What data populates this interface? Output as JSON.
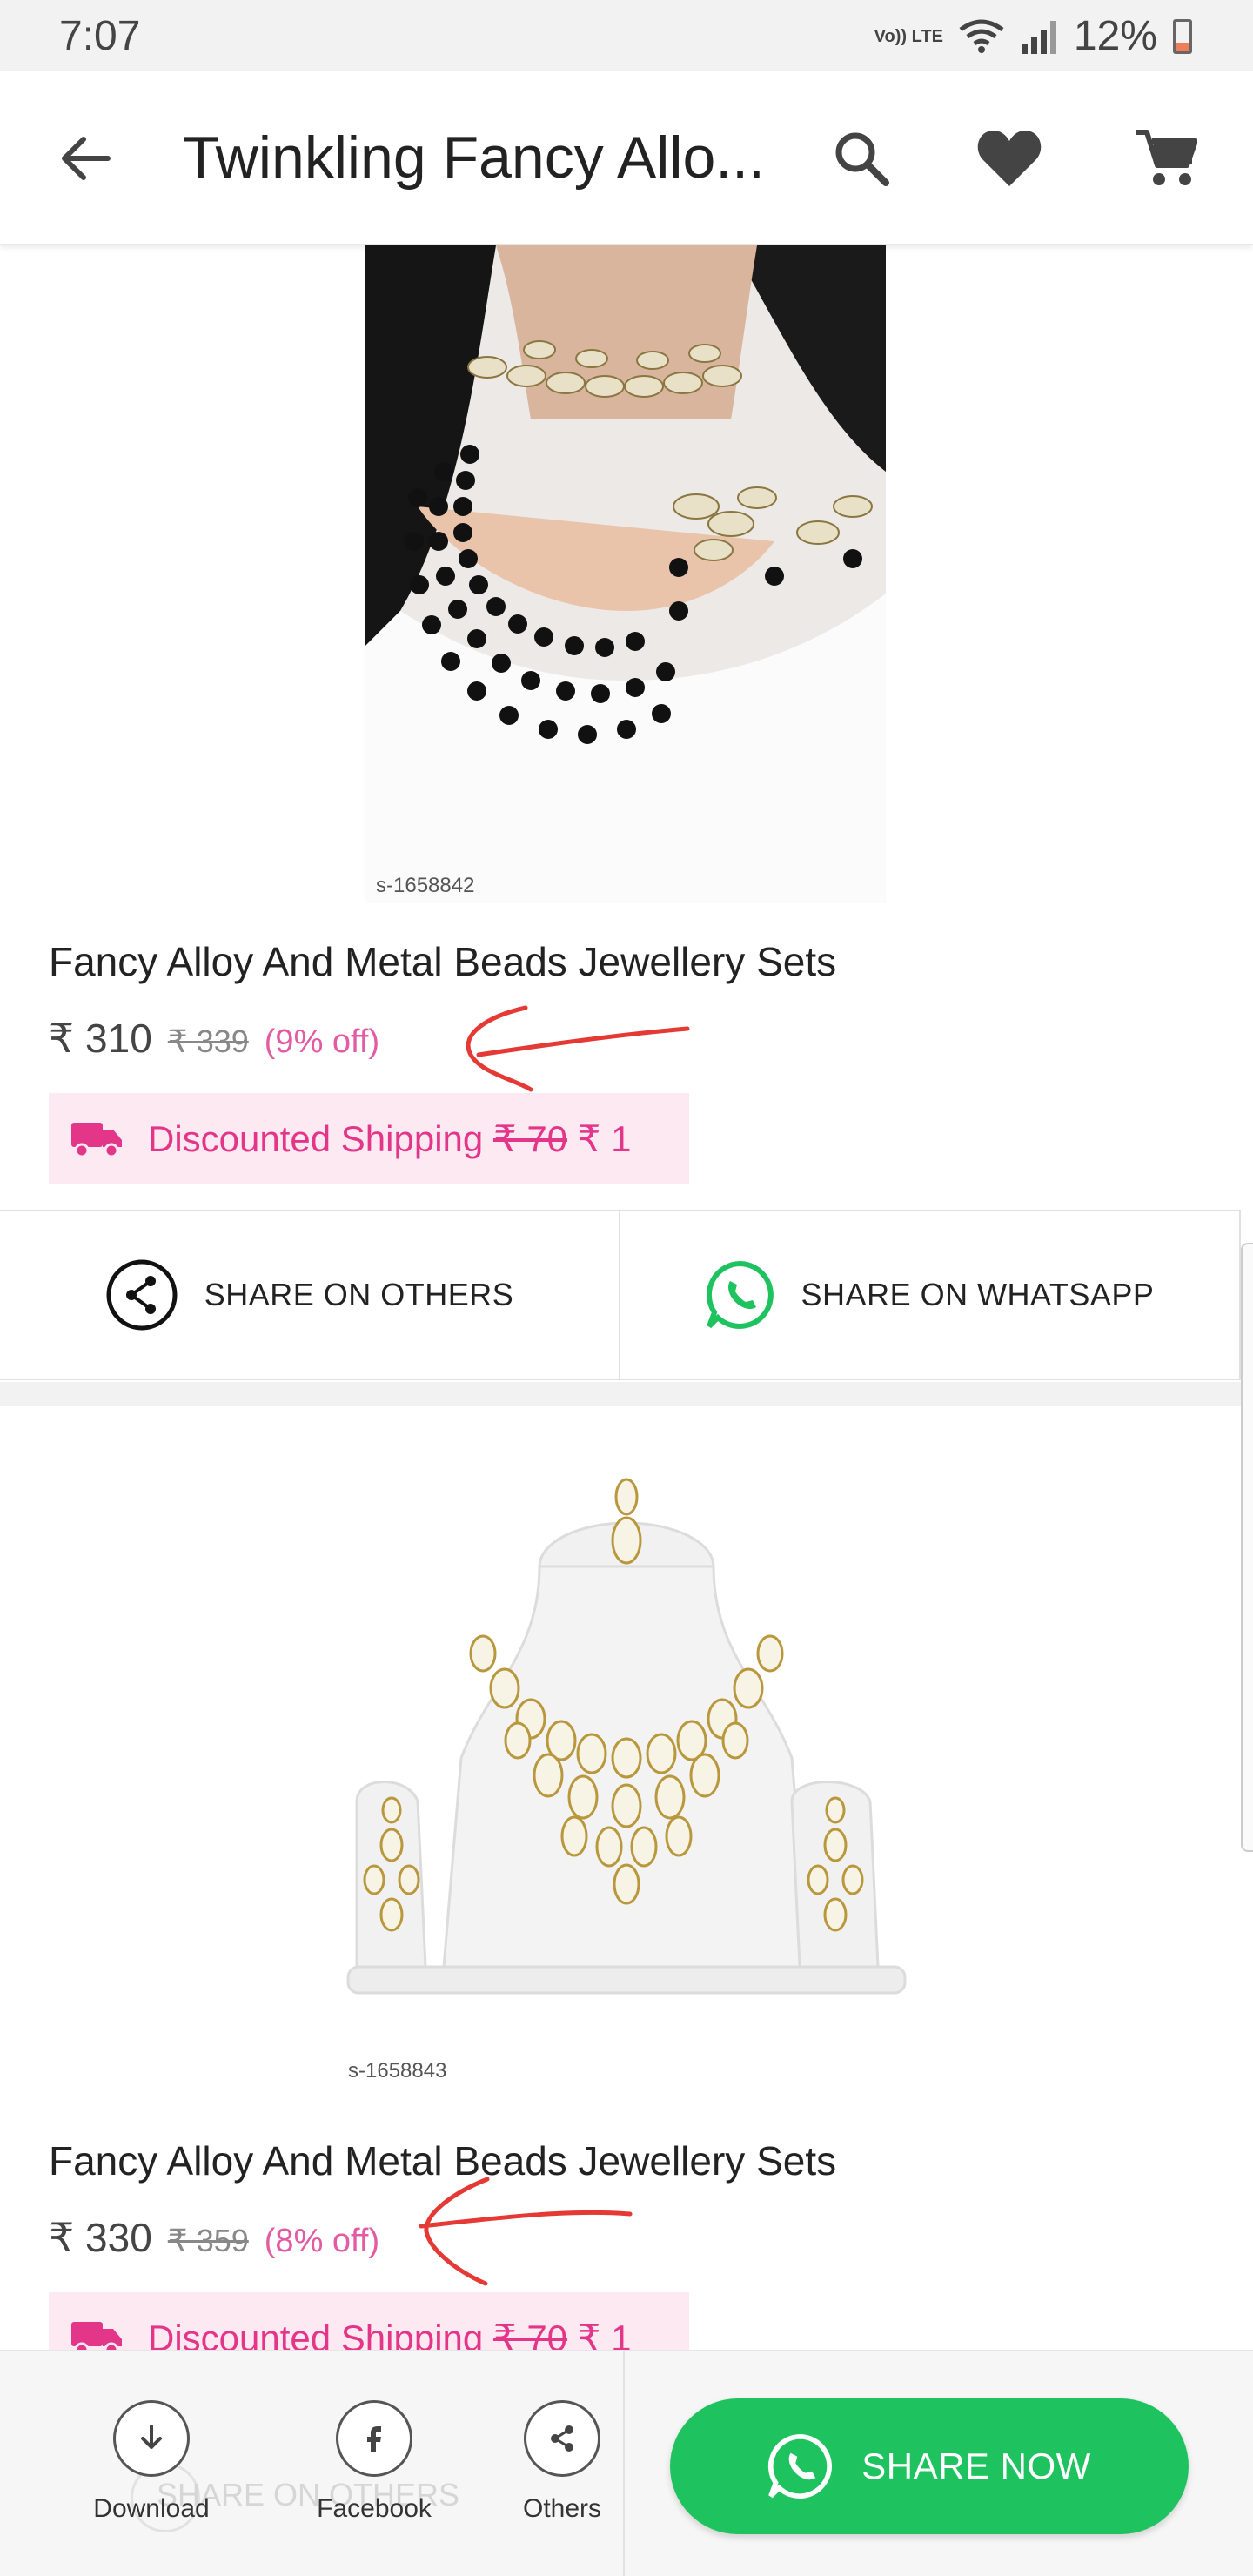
{
  "status_bar": {
    "time": "7:07",
    "network_label": "Vo)) LTE",
    "battery_percent": "12%",
    "battery_level": 0.12
  },
  "app_bar": {
    "title": "Twinkling Fancy Allo...",
    "icons": [
      "back-arrow-icon",
      "search-icon",
      "heart-icon",
      "cart-icon"
    ]
  },
  "products": [
    {
      "sku": "s-1658842",
      "title": "Fancy Alloy And Metal  Beads Jewellery Sets",
      "price": "₹ 310",
      "mrp": "₹ 339",
      "discount": "(9% off)",
      "shipping": {
        "label": "Discounted Shipping",
        "old_price": "₹ 70",
        "new_price": "₹ 1"
      }
    },
    {
      "sku": "s-1658843",
      "title": "Fancy Alloy And Metal  Beads Jewellery Sets",
      "price": "₹ 330",
      "mrp": "₹ 359",
      "discount": "(8% off)",
      "shipping": {
        "label": "Discounted Shipping",
        "old_price": "₹ 70",
        "new_price": "₹ 1"
      }
    }
  ],
  "share_row": {
    "others_label": "SHARE ON OTHERS",
    "whatsapp_label": "SHARE ON WHATSAPP"
  },
  "bottom_bar": {
    "background_text": "SHARE ON OTHERS",
    "download_label": "Download",
    "facebook_label": "Facebook",
    "others_label": "Others",
    "share_now_label": "SHARE NOW"
  },
  "colors": {
    "accent_pink": "#e33689",
    "discount_pink": "#e35ba3",
    "whatsapp_green": "#1ec35f",
    "annotation_red": "#e53935"
  }
}
